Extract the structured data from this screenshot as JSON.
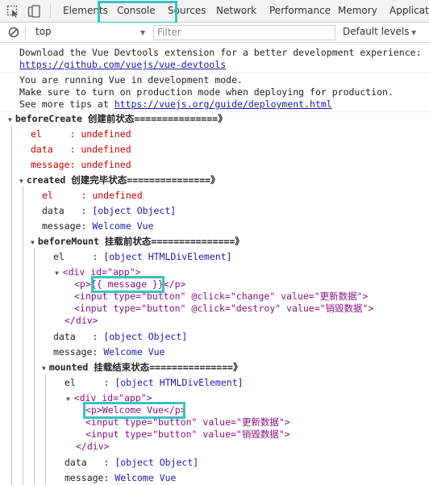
{
  "tabs": [
    "Elements",
    "Console",
    "Sources",
    "Network",
    "Performance",
    "Memory",
    "Applicati"
  ],
  "active_tab": "Console",
  "filterbar": {
    "context": "top",
    "filter_placeholder": "Filter",
    "levels": "Default levels"
  },
  "messages": {
    "devtools_1": "Download the Vue Devtools extension for a better development experience:",
    "devtools_link": "https://github.com/vuejs/vue-devtools",
    "devmode_1": "You are running Vue in development mode.",
    "devmode_2": "Make sure to turn on production mode when deploying for production.",
    "devmode_3": "See more tips at ",
    "devmode_link": "https://vuejs.org/guide/deployment.html"
  },
  "groups": {
    "beforeCreate": "beforeCreate 创建前状态===============》",
    "created": "created 创建完毕状态===============》",
    "beforeMount": "beforeMount 挂载前状态===============》",
    "mounted": "mounted 挂载结束状态===============》"
  },
  "labels": {
    "el": "el     : ",
    "data": "data   : ",
    "message": "message: "
  },
  "values": {
    "undefined": "undefined",
    "object": "[object Object]",
    "html_element": "[object HTMLDivElement]",
    "welcome": "Welcome Vue"
  },
  "dom": {
    "div_open": "<div id=\"app\">",
    "p_template": "<p>{{ message }}</p>",
    "input_update": "<input type=\"button\" @click=\"change\" value=\"更新数据\">",
    "input_destroy": "<input type=\"button\" @click=\"destroy\" value=\"销毁数据\">",
    "div_close": "</div>",
    "p_rendered": "<p>Welcome Vue</p>",
    "input_update_rendered": "<input type=\"button\" value=\"更新数据\">",
    "input_destroy_rendered": "<input type=\"button\" value=\"销毁数据\">"
  },
  "colors": {
    "highlight": "#37c3c4",
    "error_red": "#c80000",
    "string_blue": "#1a1aa6",
    "tag_purple": "#881280"
  }
}
